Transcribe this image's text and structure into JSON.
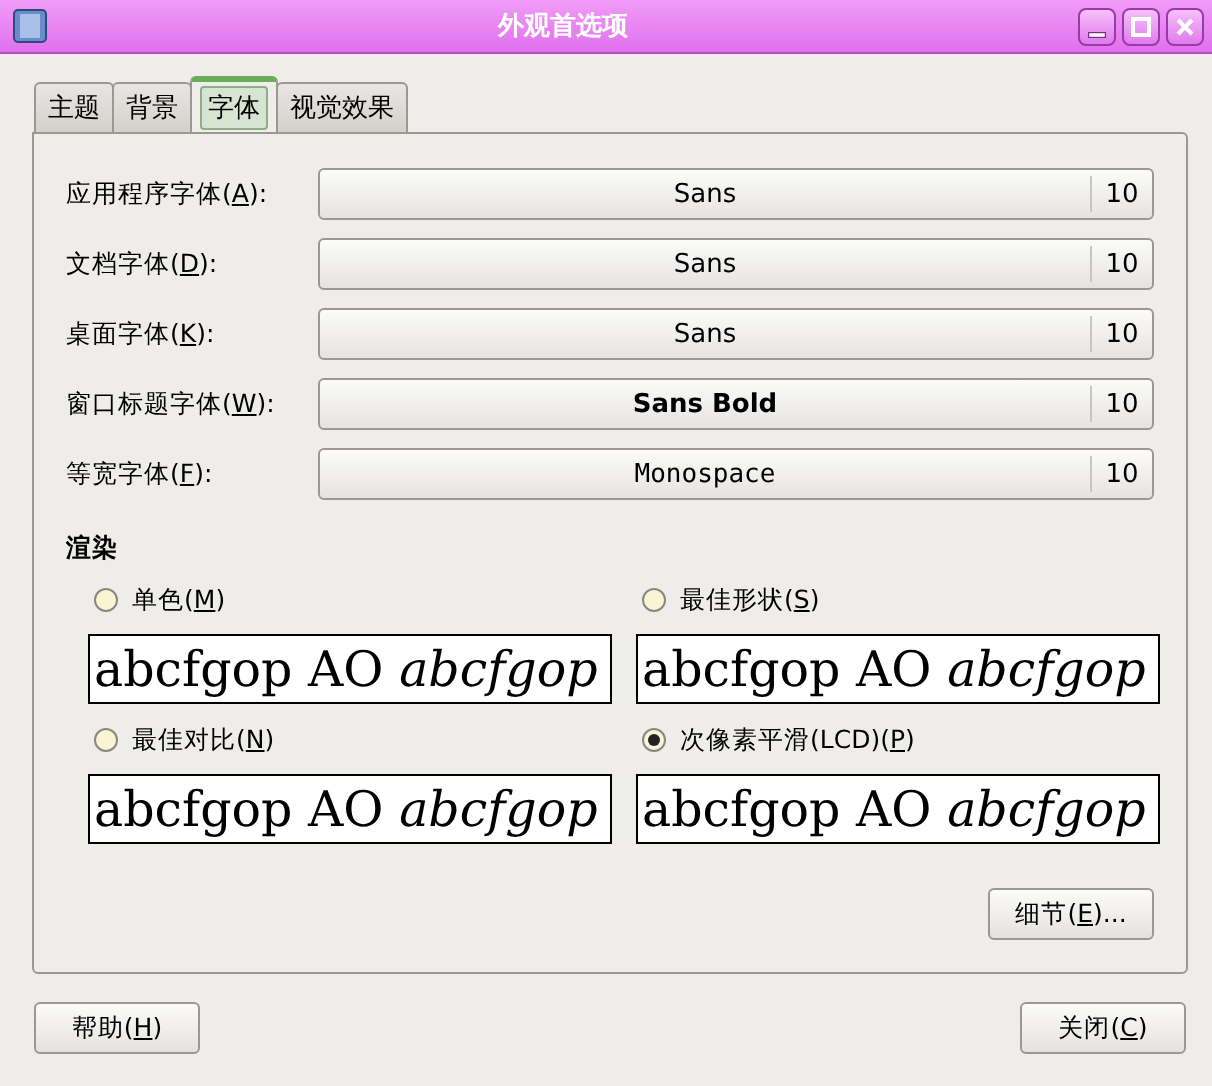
{
  "window": {
    "title": "外观首选项"
  },
  "tabs": [
    {
      "label": "主题",
      "selected": false
    },
    {
      "label": "背景",
      "selected": false
    },
    {
      "label": "字体",
      "selected": true
    },
    {
      "label": "视觉效果",
      "selected": false
    }
  ],
  "fonts": [
    {
      "label_before": "应用程序字体(",
      "mnemonic": "A",
      "label_after": "):",
      "font": "Sans",
      "kind": "regular",
      "size": "10"
    },
    {
      "label_before": "文档字体(",
      "mnemonic": "D",
      "label_after": "):",
      "font": "Sans",
      "kind": "regular",
      "size": "10"
    },
    {
      "label_before": "桌面字体(",
      "mnemonic": "K",
      "label_after": "):",
      "font": "Sans",
      "kind": "regular",
      "size": "10"
    },
    {
      "label_before": "窗口标题字体(",
      "mnemonic": "W",
      "label_after": "):",
      "font": "Sans Bold",
      "kind": "bold",
      "size": "10"
    },
    {
      "label_before": "等宽字体(",
      "mnemonic": "F",
      "label_after": "):",
      "font": "Monospace",
      "kind": "mono",
      "size": "10"
    }
  ],
  "rendering": {
    "title": "渲染",
    "options": [
      {
        "label_before": "单色(",
        "mnemonic": "M",
        "label_after": ")",
        "selected": false,
        "preview": "abcfgop AO *abcfgop*"
      },
      {
        "label_before": "最佳形状(",
        "mnemonic": "S",
        "label_after": ")",
        "selected": false,
        "preview": "abcfgop AO *abcfgop*"
      },
      {
        "label_before": "最佳对比(",
        "mnemonic": "N",
        "label_after": ")",
        "selected": false,
        "preview": "abcfgop AO *abcfgop*"
      },
      {
        "label_before": "次像素平滑(LCD)(",
        "mnemonic": "P",
        "label_after": ")",
        "selected": true,
        "preview": "abcfgop AO *abcfgop*"
      }
    ]
  },
  "details_button": {
    "label_before": "细节(",
    "mnemonic": "E",
    "label_after": ")..."
  },
  "buttons": [
    {
      "label_before": "帮助(",
      "mnemonic": "H",
      "label_after": ")"
    },
    {
      "label_before": "关闭(",
      "mnemonic": "C",
      "label_after": ")"
    }
  ]
}
